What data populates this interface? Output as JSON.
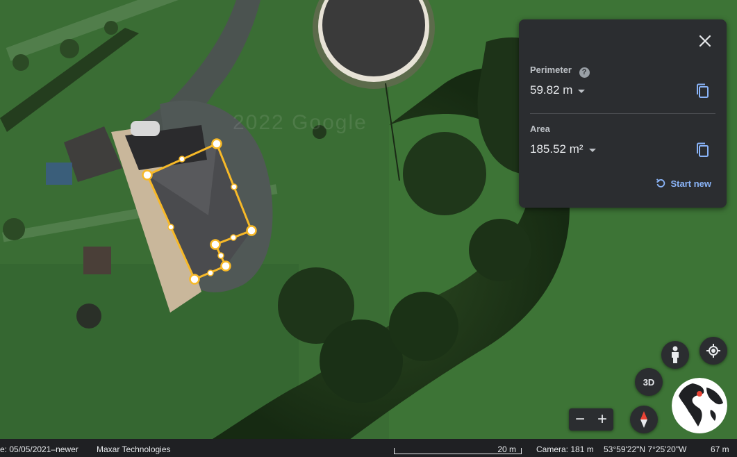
{
  "map": {
    "watermark": "2022 Google"
  },
  "measure_panel": {
    "perimeter_label": "Perimeter",
    "perimeter_value": "59.82 m",
    "area_label": "Area",
    "area_value": "185.52 m²",
    "start_new_label": "Start new",
    "help_glyph": "?",
    "accent_color": "#8ab4f8"
  },
  "controls": {
    "button_3d": "3D",
    "zoom_out": "−",
    "zoom_in": "+"
  },
  "statusbar": {
    "imagery_date": "e: 05/05/2021–newer",
    "provider": "Maxar Technologies",
    "scale": "20 m",
    "camera": "Camera: 181 m",
    "coordinates": "53°59'22\"N 7°25'20\"W",
    "elevation": "67 m"
  },
  "icons": [
    "close-icon",
    "help-icon",
    "copy-icon",
    "refresh-icon",
    "pegman-icon",
    "my-location-icon",
    "compass-icon",
    "globe-icon"
  ]
}
